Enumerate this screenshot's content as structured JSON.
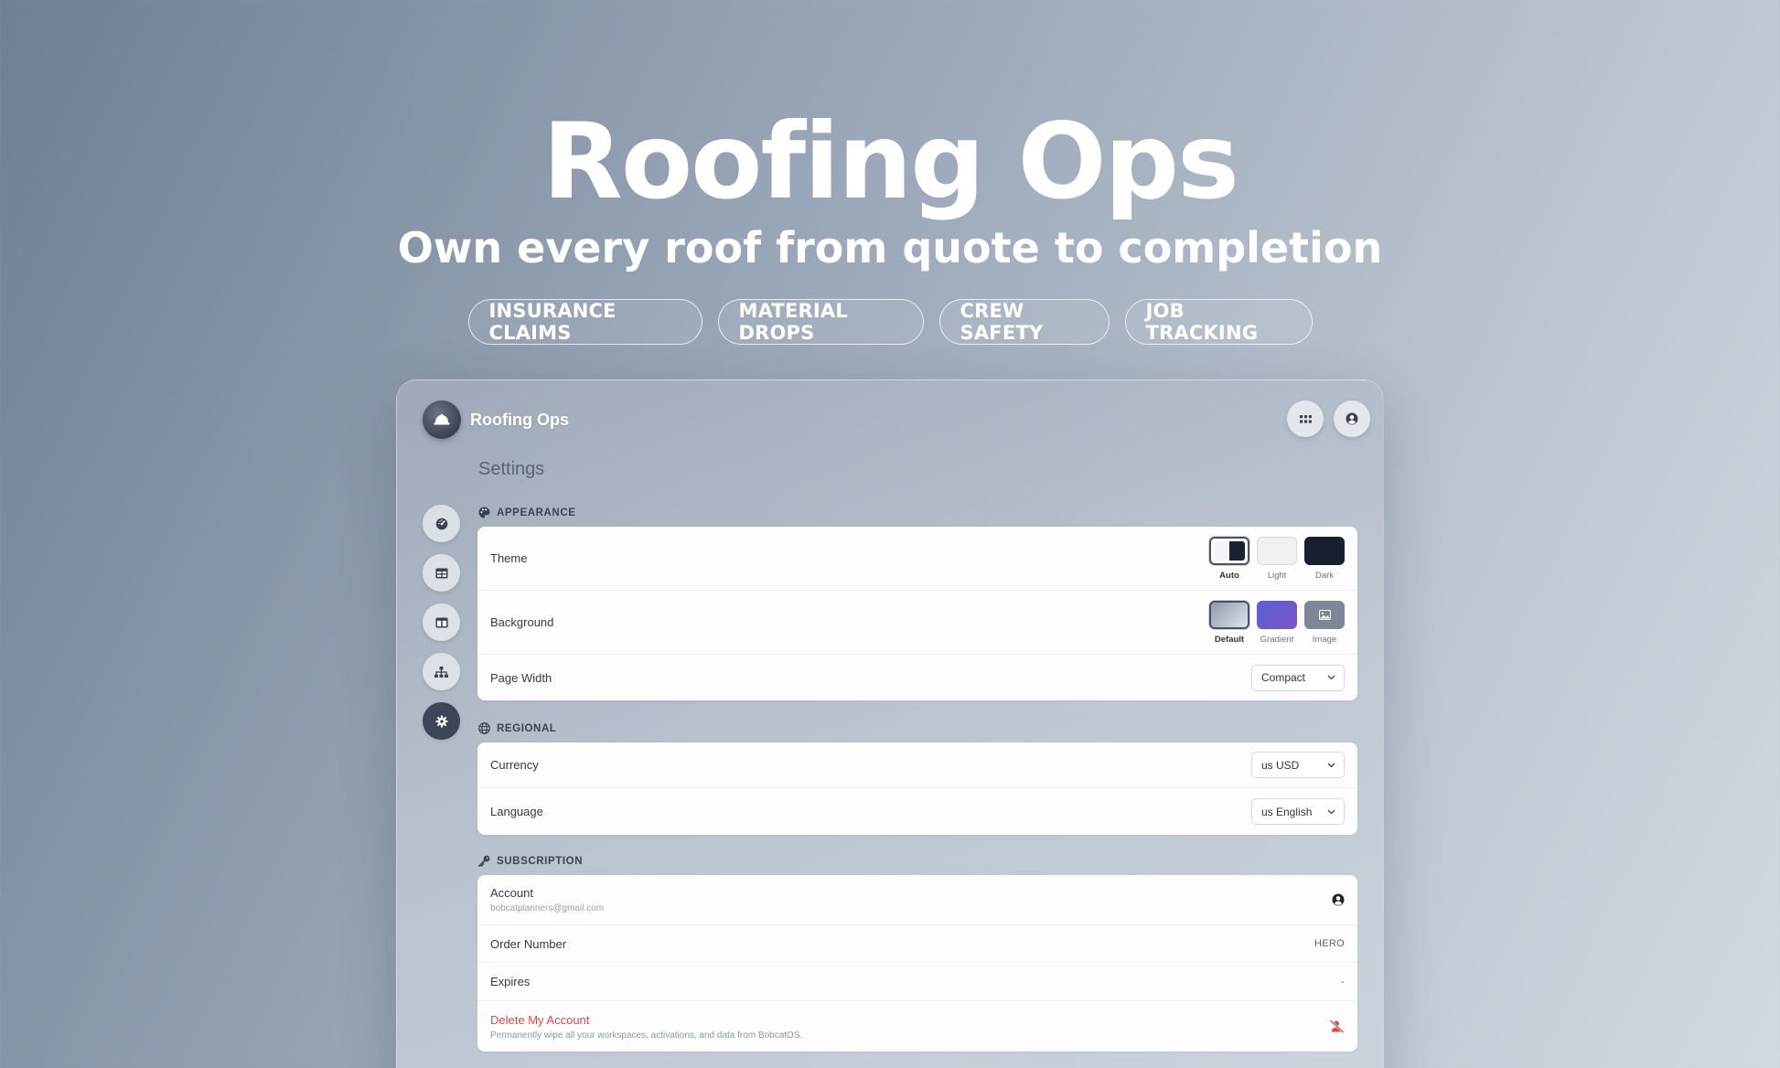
{
  "hero": {
    "title": "Roofing Ops",
    "subtitle": "Own every roof from quote to completion",
    "pills": [
      "INSURANCE CLAIMS",
      "MATERIAL DROPS",
      "CREW SAFETY",
      "JOB TRACKING"
    ]
  },
  "app": {
    "brand_name": "Roofing Ops",
    "page_title": "Settings",
    "sections": {
      "appearance": {
        "label": "APPEARANCE",
        "theme": {
          "label": "Theme",
          "options": [
            "Auto",
            "Light",
            "Dark"
          ],
          "selected": "Auto"
        },
        "background": {
          "label": "Background",
          "options": [
            "Default",
            "Gradient",
            "Image"
          ],
          "selected": "Default"
        },
        "page_width": {
          "label": "Page Width",
          "value": "Compact"
        }
      },
      "regional": {
        "label": "REGIONAL",
        "currency": {
          "label": "Currency",
          "value": "us USD"
        },
        "language": {
          "label": "Language",
          "value": "us English"
        }
      },
      "subscription": {
        "label": "SUBSCRIPTION",
        "account": {
          "label": "Account",
          "email": "bobcatplanners@gmail.com"
        },
        "order_number": {
          "label": "Order Number",
          "value": "HERO"
        },
        "expires": {
          "label": "Expires",
          "value": "-"
        },
        "delete": {
          "label": "Delete My Account",
          "description": "Permanently wipe all your workspaces, activations, and data from BobcatOS."
        }
      }
    },
    "icons": {
      "brand": "hard-hat-icon",
      "top_actions": [
        "apps-grid-icon",
        "user-circle-icon"
      ],
      "nav": [
        "dashboard-gauge-icon",
        "table-icon",
        "layout-icon",
        "sitemap-icon",
        "settings-gear-icon"
      ]
    }
  },
  "colors": {
    "danger": "#e04848",
    "nav_active": "#3c4658"
  }
}
